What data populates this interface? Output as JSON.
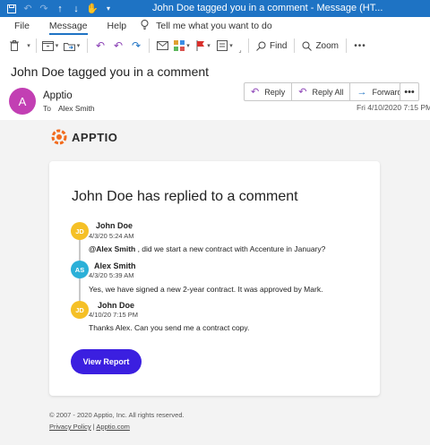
{
  "window": {
    "title": "John Doe tagged you in a comment  -  Message (HT..."
  },
  "menu": {
    "items": [
      "File",
      "Message",
      "Help"
    ],
    "tell_me": "Tell me what you want to do"
  },
  "toolbar": {
    "find_label": "Find",
    "zoom_label": "Zoom"
  },
  "message": {
    "subject": "John Doe tagged you in a comment",
    "sender_initial": "A",
    "sender": "Apptio",
    "to_label": "To",
    "to_name": "Alex Smith",
    "date": "Fri 4/10/2020 7:15 PM",
    "actions": {
      "reply": "Reply",
      "reply_all": "Reply All",
      "forward": "Forward",
      "more": "•••"
    }
  },
  "email": {
    "brand": "APPTIO",
    "card_title": "John Doe has replied to a comment",
    "comments": [
      {
        "initials": "JD",
        "name": "John Doe",
        "time": "4/3/20 5:24 AM",
        "mention": "@Alex Smith",
        "text": " , did we start a new contract with Accenture in January?",
        "color": "#f5c026"
      },
      {
        "initials": "AS",
        "name": "Alex Smith",
        "time": "4/3/20 5:39 AM",
        "text": "Yes, we have signed a new 2-year contract. It was approved by Mark.",
        "color": "#2bb0d8"
      },
      {
        "initials": "JD",
        "name": "John Doe",
        "time": "4/10/20 7:15 PM",
        "text": "Thanks Alex. Can you send me a contract copy.",
        "color": "#f5c026"
      }
    ],
    "button": "View Report",
    "button_color": "#3b1fe0",
    "footer": {
      "copyright": "© 2007 - 2020 Apptio, Inc. All rights reserved.",
      "privacy": "Privacy Policy",
      "separator": " | ",
      "site": "Apptio.com"
    }
  },
  "colors": {
    "titlebar": "#1e73c4",
    "avatar_sender": "#c23fb3",
    "brand_orange": "#f26b1d"
  }
}
